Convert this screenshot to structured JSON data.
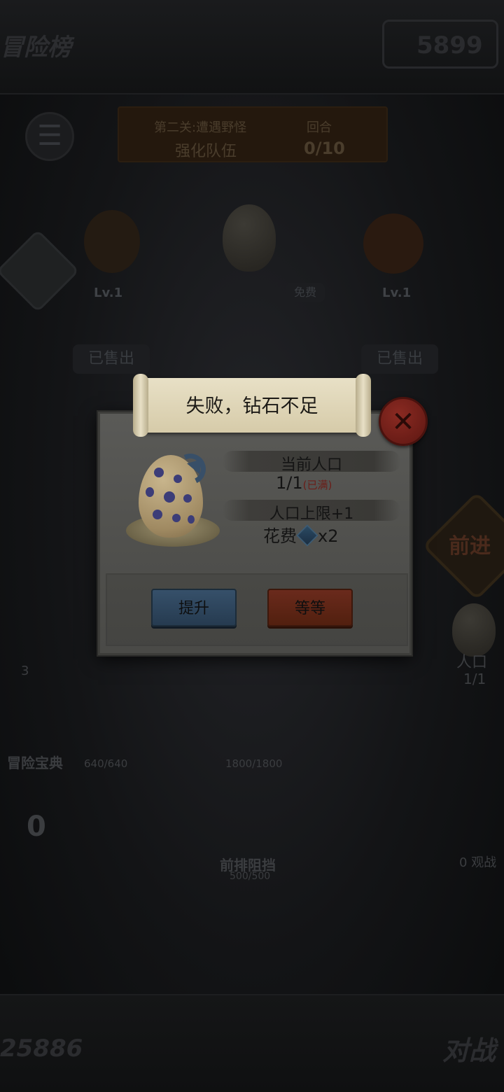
{
  "background": {
    "top_left_label": "冒险榜",
    "top_right_value": "5899",
    "stage": {
      "title": "第二关:遭遇野怪",
      "task": "强化队伍",
      "round_label": "回合",
      "round_value": "0/10"
    },
    "slots": {
      "left_level": "Lv.1",
      "center_price": "免费",
      "right_level": "Lv.1",
      "sold_left": "已售出",
      "sold_right": "已售出"
    },
    "forward_label": "前进",
    "population_label": "人口",
    "population_value": "1/1",
    "apple_count": "3",
    "guide_label": "冒险宝典",
    "unit1_hp": "640/640",
    "unit2_hp": "1800/1800",
    "front_block_label": "前排阻挡",
    "front_block_hp": "500/500",
    "bag_count": "0",
    "spectate_label": "0 观战",
    "bottom_left_value": "25886",
    "bottom_right_label": "对战"
  },
  "dialog": {
    "title": "失败，钻石不足",
    "current_population_label": "当前人口",
    "current_population_value": "1/1",
    "full_tag": "(已满)",
    "upgrade_label": "人口上限+1",
    "cost_label": "花费",
    "cost_amount": "x2",
    "upgrade_button": "提升",
    "wait_button": "等等"
  },
  "colors": {
    "dialog_panel": "#4f4f4c",
    "title_scroll": "#e0d7b8",
    "button_blue": "#2f4760",
    "button_red": "#5e2516",
    "close_button": "#7a221b"
  }
}
